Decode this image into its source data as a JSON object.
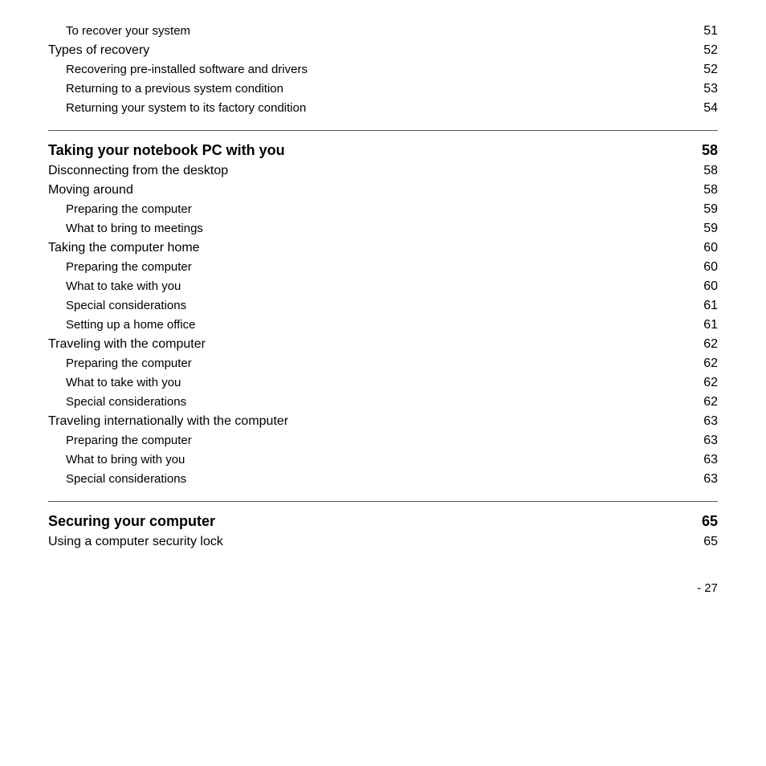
{
  "entries_top": [
    {
      "level": "level-1",
      "text": "To recover your system",
      "page": "51"
    },
    {
      "level": "level-0",
      "text": "Types of recovery",
      "page": "52"
    },
    {
      "level": "level-1",
      "text": "Recovering pre-installed software and drivers",
      "page": "52"
    },
    {
      "level": "level-1",
      "text": "Returning to a previous system condition",
      "page": "53"
    },
    {
      "level": "level-1",
      "text": "Returning your system to its factory condition",
      "page": "54"
    }
  ],
  "section1": {
    "title": "Taking your notebook PC with you",
    "page": "58"
  },
  "entries_section1": [
    {
      "level": "level-0",
      "text": "Disconnecting from the desktop",
      "page": "58"
    },
    {
      "level": "level-0",
      "text": "Moving around",
      "page": "58"
    },
    {
      "level": "level-1",
      "text": "Preparing the computer",
      "page": "59"
    },
    {
      "level": "level-1",
      "text": "What to bring to meetings",
      "page": "59"
    },
    {
      "level": "level-0",
      "text": "Taking the computer home",
      "page": "60"
    },
    {
      "level": "level-1",
      "text": "Preparing the computer",
      "page": "60"
    },
    {
      "level": "level-1",
      "text": "What to take with you",
      "page": "60"
    },
    {
      "level": "level-1",
      "text": "Special considerations",
      "page": "61"
    },
    {
      "level": "level-1",
      "text": "Setting up a home office",
      "page": "61"
    },
    {
      "level": "level-0",
      "text": "Traveling with the computer",
      "page": "62"
    },
    {
      "level": "level-1",
      "text": "Preparing the computer",
      "page": "62"
    },
    {
      "level": "level-1",
      "text": "What to take with you",
      "page": "62"
    },
    {
      "level": "level-1",
      "text": "Special considerations",
      "page": "62"
    },
    {
      "level": "level-0",
      "text": "Traveling internationally with the computer",
      "page": "63"
    },
    {
      "level": "level-1",
      "text": "Preparing the computer",
      "page": "63"
    },
    {
      "level": "level-1",
      "text": "What to bring with you",
      "page": "63"
    },
    {
      "level": "level-1",
      "text": "Special considerations",
      "page": "63"
    }
  ],
  "section2": {
    "title": "Securing your computer",
    "page": "65"
  },
  "entries_section2": [
    {
      "level": "level-0",
      "text": "Using a computer security lock",
      "page": "65"
    }
  ],
  "footer": {
    "text": "- 27"
  }
}
